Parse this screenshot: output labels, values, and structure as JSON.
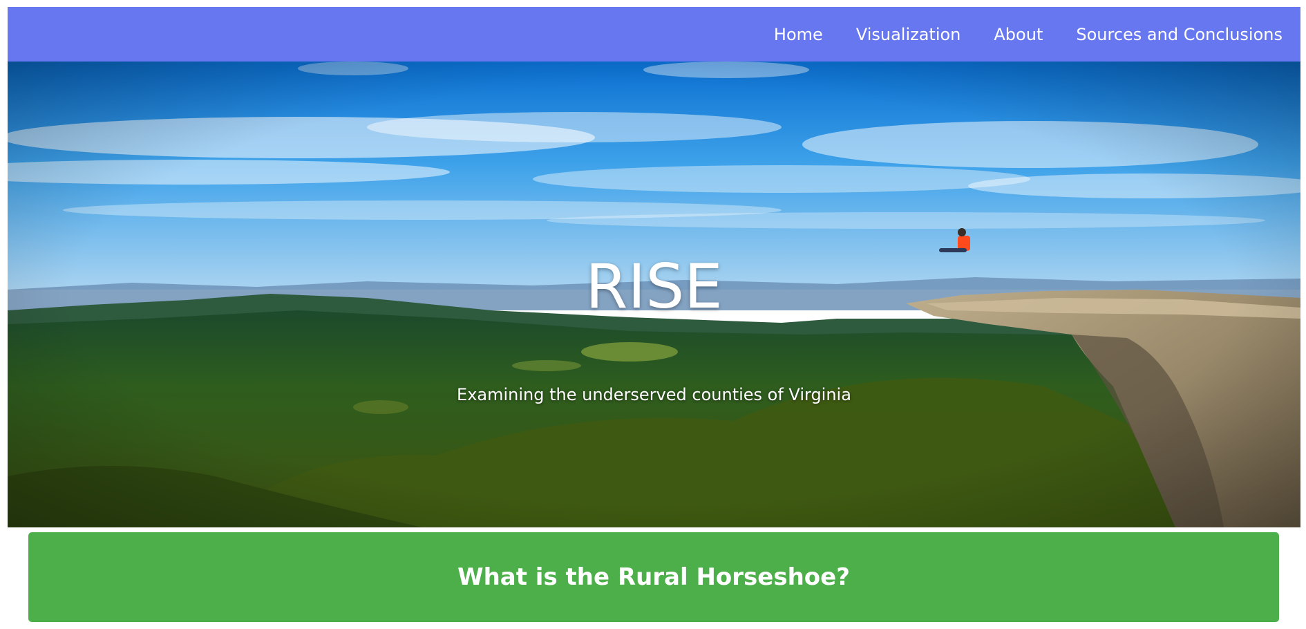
{
  "nav": {
    "items": [
      {
        "label": "Home"
      },
      {
        "label": "Visualization"
      },
      {
        "label": "About"
      },
      {
        "label": "Sources and Conclusions"
      }
    ]
  },
  "hero": {
    "title": "RISE",
    "subtitle": "Examining the underserved counties of Virginia"
  },
  "card": {
    "title": "What is the Rural Horseshoe?"
  },
  "colors": {
    "navbar": "#6777ef",
    "card": "#4caf4a",
    "text": "#ffffff"
  }
}
